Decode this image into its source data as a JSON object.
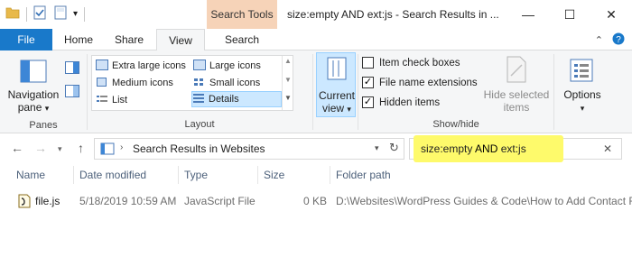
{
  "window": {
    "title": "size:empty AND ext:js - Search Results in ...",
    "context_tab_header": "Search Tools",
    "minimize_glyph": "—",
    "maximize_glyph": "☐",
    "close_glyph": "✕"
  },
  "ribbon_tabs": {
    "file": "File",
    "home": "Home",
    "share": "Share",
    "view": "View",
    "search": "Search",
    "active": "View"
  },
  "panes_group": {
    "navigation_pane_line1": "Navigation",
    "navigation_pane_line2": "pane",
    "label": "Panes"
  },
  "layout_group": {
    "items": [
      "Extra large icons",
      "Large icons",
      "Medium icons",
      "Small icons",
      "List",
      "Details"
    ],
    "selected": "Details",
    "label": "Layout"
  },
  "current_view_group": {
    "line1": "Current",
    "line2": "view"
  },
  "show_hide_group": {
    "item_check_boxes": "Item check boxes",
    "item_check_boxes_checked": false,
    "file_name_extensions": "File name extensions",
    "file_name_extensions_checked": true,
    "hidden_items": "Hidden items",
    "hidden_items_checked": true,
    "hide_selected_line1": "Hide selected",
    "hide_selected_line2": "items",
    "label": "Show/hide"
  },
  "options_group": {
    "label": "Options"
  },
  "address_bar": {
    "path": "Search Results in Websites"
  },
  "search_box": {
    "query_part1": "size:empty ",
    "query_and": "AND",
    "query_part2": " ext:js",
    "highlight_color": "#fefa6b"
  },
  "columns": [
    "Name",
    "Date modified",
    "Type",
    "Size",
    "Folder path"
  ],
  "files": [
    {
      "name": "file.js",
      "date_modified": "5/18/2019 10:59 AM",
      "type": "JavaScript File",
      "size": "0 KB",
      "folder_path": "D:\\Websites\\WordPress Guides & Code\\How to Add Contact F"
    }
  ],
  "colors": {
    "file_tab": "#1979ca",
    "context_tab": "#f6d3b8",
    "selection": "#cce8ff"
  }
}
